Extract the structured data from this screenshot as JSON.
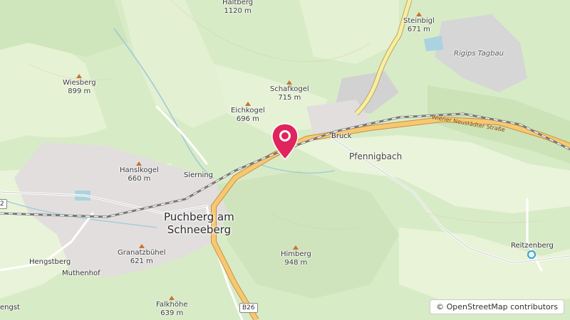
{
  "map": {
    "type": "topographic",
    "marker": {
      "name": "selected-location",
      "color": "#e0245e"
    },
    "towns": [
      {
        "id": "puchberg",
        "line1": "Puchberg am",
        "line2": "Schneeberg"
      }
    ],
    "places": [
      {
        "id": "pfennigbach",
        "name": "Pfennigbach"
      }
    ],
    "villages": [
      {
        "id": "siering",
        "name": "Sierning"
      },
      {
        "id": "bruck",
        "name": "Bruck"
      },
      {
        "id": "hengstberg",
        "name": "Hengstberg"
      },
      {
        "id": "muthenhof",
        "name": "Muthenhof"
      },
      {
        "id": "reitzenberg",
        "name": "Reitzenberg"
      },
      {
        "id": "engst",
        "name": "engst"
      }
    ],
    "peaks": [
      {
        "id": "haltberg",
        "name": "Haltberg",
        "elev": "1120 m"
      },
      {
        "id": "steinbigl",
        "name": "Steinbigl",
        "elev": "671 m"
      },
      {
        "id": "wiesberg",
        "name": "Wiesberg",
        "elev": "899 m"
      },
      {
        "id": "schafkogel",
        "name": "Schafkogel",
        "elev": "715 m"
      },
      {
        "id": "eichkogel",
        "name": "Eichkogel",
        "elev": "696 m"
      },
      {
        "id": "hanslkogel",
        "name": "Hanslkogel",
        "elev": "660 m"
      },
      {
        "id": "granatzbuhel",
        "name": "Granatzbühel",
        "elev": "621 m"
      },
      {
        "id": "himberg",
        "name": "Himberg",
        "elev": "948 m"
      },
      {
        "id": "falkhohe",
        "name": "Falkhöhe",
        "elev": "639 m"
      }
    ],
    "areas": [
      {
        "id": "rigips",
        "name": "Rigips Tagbau"
      }
    ],
    "streets": [
      {
        "id": "wiener",
        "name": "Wiener Neustädter Straße"
      }
    ],
    "road_shields": [
      {
        "id": "b26",
        "name": "B26"
      },
      {
        "id": "left-edge",
        "name": "2"
      }
    ],
    "attribution": "© OpenStreetMap contributors"
  }
}
